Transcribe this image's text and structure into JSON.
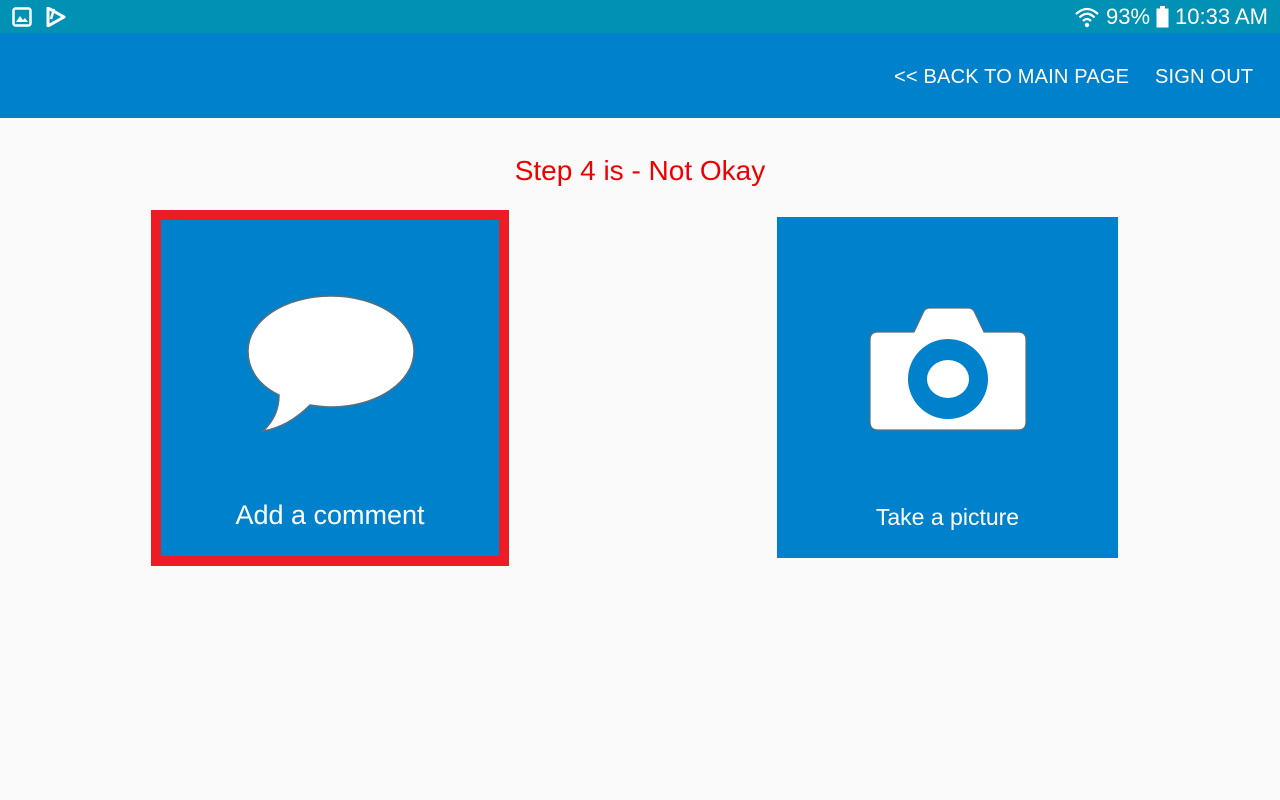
{
  "status_bar": {
    "battery": "93%",
    "time": "10:33 AM",
    "left_icons": [
      "image-icon",
      "play-store-icon"
    ],
    "right_icons": [
      "wifi-icon",
      "battery-icon"
    ]
  },
  "header": {
    "back_label": "<< BACK TO MAIN PAGE",
    "sign_out_label": "SIGN OUT"
  },
  "main": {
    "title": "Step 4 is - Not Okay",
    "tiles": [
      {
        "label": "Add a comment",
        "icon": "speech-bubble-icon",
        "selected": true
      },
      {
        "label": "Take a picture",
        "icon": "camera-icon",
        "selected": false
      }
    ]
  },
  "colors": {
    "status_bar": "#0091b4",
    "app_bar": "#0081cb",
    "tile": "#0081cb",
    "title_text": "#ee0000",
    "selection_border": "#ec1c24",
    "background": "#fafafa"
  }
}
